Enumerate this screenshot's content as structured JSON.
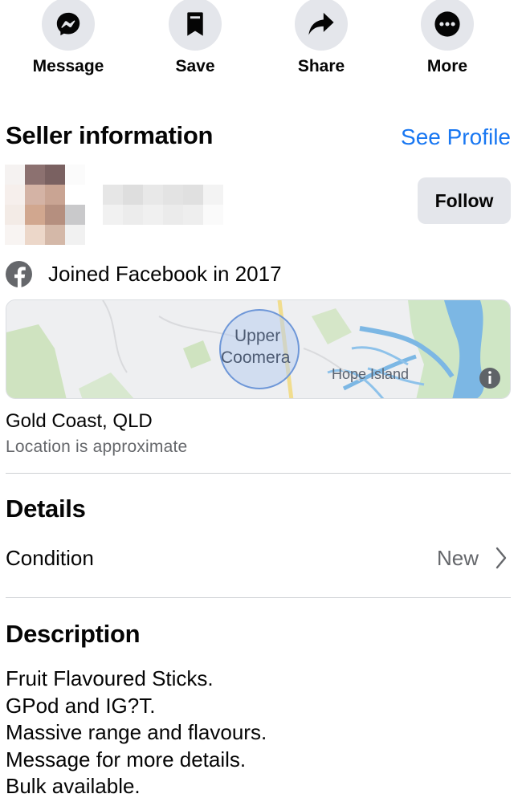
{
  "actions": [
    {
      "label": "Message",
      "icon": "messenger-icon"
    },
    {
      "label": "Save",
      "icon": "bookmark-icon"
    },
    {
      "label": "Share",
      "icon": "share-arrow-icon"
    },
    {
      "label": "More",
      "icon": "more-dots-icon"
    }
  ],
  "seller": {
    "title": "Seller information",
    "see_profile": "See Profile",
    "follow": "Follow",
    "joined": "Joined Facebook in 2017"
  },
  "map": {
    "label_upper": "Upper",
    "label_coomera": "Coomera",
    "label_hope": "Hope Island"
  },
  "location": {
    "name": "Gold Coast, QLD",
    "note": "Location is approximate"
  },
  "details": {
    "title": "Details",
    "condition_label": "Condition",
    "condition_value": "New"
  },
  "description": {
    "title": "Description",
    "lines": [
      "Fruit Flavoured Sticks.",
      "GPod and IG?T.",
      "Massive range and flavours.",
      "Message for more details.",
      "Bulk available."
    ]
  },
  "colors": {
    "link": "#1877f2",
    "button_bg": "#e4e6eb",
    "secondary_text": "#65676b"
  }
}
